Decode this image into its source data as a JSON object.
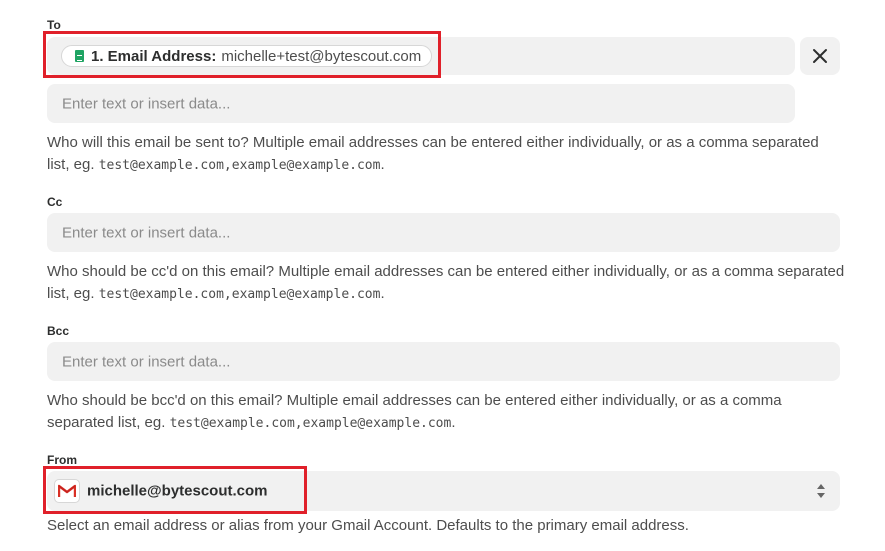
{
  "to": {
    "label": "To",
    "chip": {
      "step_label": "1. Email Address:",
      "value": "michelle+test@bytescout.com"
    },
    "extra_placeholder": "Enter text or insert data...",
    "help_prefix": "Who will this email be sent to? Multiple email addresses can be entered either individually, or as a comma separated list, eg. ",
    "help_example": "test@example.com,example@example.com",
    "help_suffix": "."
  },
  "cc": {
    "label": "Cc",
    "placeholder": "Enter text or insert data...",
    "help_prefix": "Who should be cc'd on this email? Multiple email addresses can be entered either individually, or as a comma separated list, eg. ",
    "help_example": "test@example.com,example@example.com",
    "help_suffix": "."
  },
  "bcc": {
    "label": "Bcc",
    "placeholder": "Enter text or insert data...",
    "help_prefix": "Who should be bcc'd on this email? Multiple email addresses can be entered either individually, or as a comma separated list, eg. ",
    "help_example": "test@example.com,example@example.com",
    "help_suffix": "."
  },
  "from": {
    "label": "From",
    "value": "michelle@bytescout.com",
    "icon": "gmail-icon",
    "help": "Select an email address or alias from your Gmail Account. Defaults to the primary email address."
  },
  "colors": {
    "highlight": "#e0202a",
    "field_bg": "#f1f1f1",
    "sheets_green": "#1fa463"
  }
}
